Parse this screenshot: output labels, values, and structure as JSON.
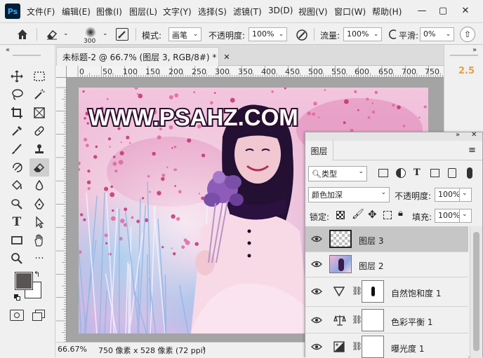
{
  "app": {
    "logo": "Ps"
  },
  "menu": [
    "文件(F)",
    "编辑(E)",
    "图像(I)",
    "图层(L)",
    "文字(Y)",
    "选择(S)",
    "滤镜(T)",
    "3D(D)",
    "视图(V)",
    "窗口(W)",
    "帮助(H)"
  ],
  "options": {
    "brush_size": "300",
    "mode_label": "模式:",
    "mode_value": "画笔",
    "opacity_label": "不透明度:",
    "opacity_value": "100%",
    "flow_label": "流量:",
    "flow_value": "100%",
    "smooth_label": "平滑:",
    "smooth_value": "0%"
  },
  "document": {
    "tab_title": "未标题-2 @ 66.7% (图层 3, RGB/8#) *",
    "ruler_labels": [
      "0",
      "50",
      "100",
      "150",
      "200",
      "250",
      "300",
      "350",
      "400",
      "450",
      "500",
      "550",
      "600",
      "650",
      "700",
      "750"
    ],
    "watermark": "WWW.PSAHZ.COM",
    "zoom": "66.67%",
    "doc_info": "750 像素 x 528 像素 (72 ppi)"
  },
  "right_panel": {
    "value": "2.5"
  },
  "layers_panel": {
    "title": "图层",
    "filter_label": "类型",
    "blend_mode": "颜色加深",
    "opacity_label": "不透明度:",
    "opacity_value": "100%",
    "lock_label": "锁定:",
    "fill_label": "填充:",
    "fill_value": "100%",
    "layers": [
      {
        "name": "图层 3",
        "kind": "pixel",
        "selected": true
      },
      {
        "name": "图层 2",
        "kind": "pixel",
        "selected": false
      },
      {
        "name": "自然饱和度 1",
        "kind": "adjustment",
        "icon": "vibrance-icon",
        "selected": false
      },
      {
        "name": "色彩平衡 1",
        "kind": "adjustment",
        "icon": "color-balance-icon",
        "selected": false
      },
      {
        "name": "曝光度 1",
        "kind": "adjustment",
        "icon": "exposure-icon",
        "selected": false
      }
    ]
  },
  "colors": {
    "foreground": "#5a5555",
    "background": "#ffffff",
    "accent": "#e8a040"
  }
}
